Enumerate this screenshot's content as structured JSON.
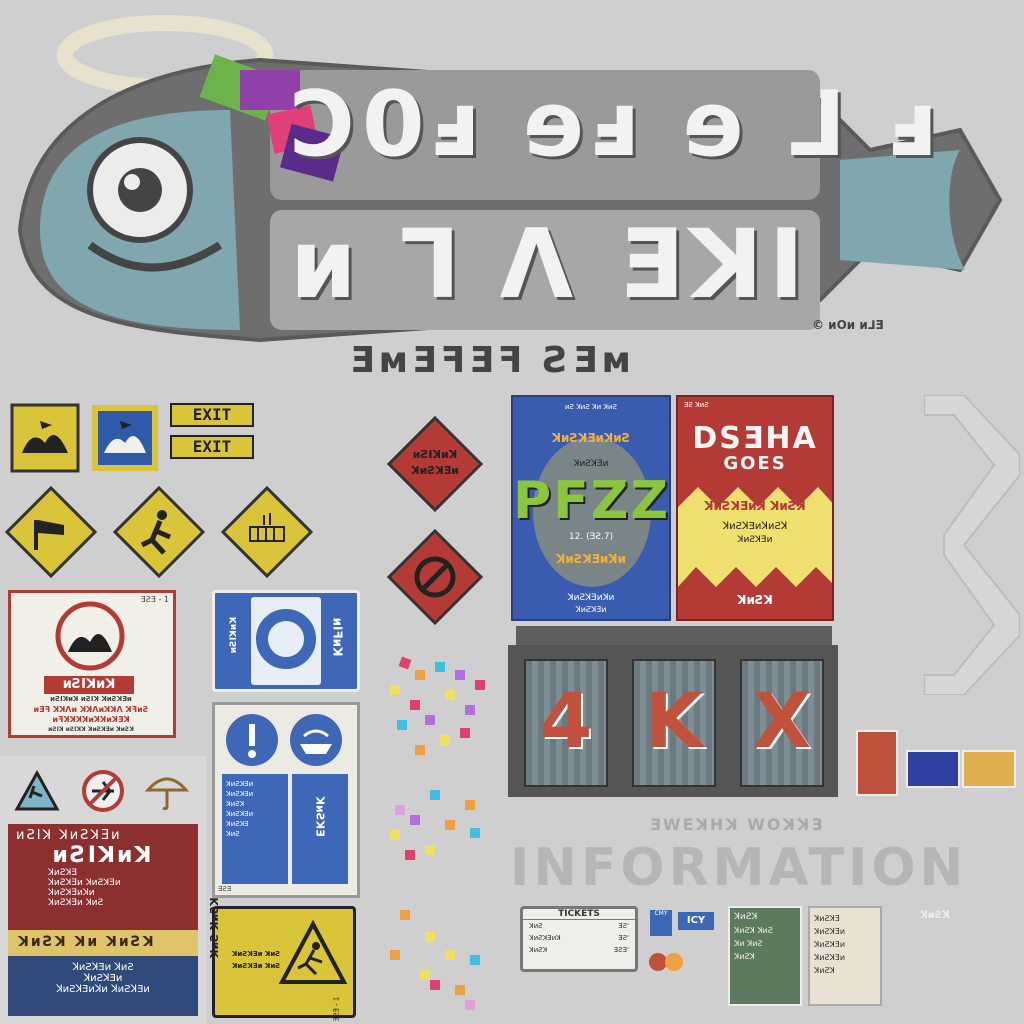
{
  "logo": {
    "line1": "Ↄ0ⅎ ɘⅎ ɘ ⅃ ⅎ",
    "line2": "ᴎ ⅂ Ʌ ƎꓘI",
    "subtitle": "ƎᴍƎꟻƎꟻ ƧƎᴍ",
    "copyright": "© ᴎОᴎ ᴎ⅃Ǝ"
  },
  "exit_signs": {
    "right": "EXIT",
    "left": "EXIT"
  },
  "diamond_sign": {
    "line1": "ᴎƧIꓘᴎꓘ",
    "line2": "ꓘᴎƧꓘƎᴎ"
  },
  "warning_card": {
    "code": "ƎƧƎ - 1",
    "title": "ᴎƧIꓘᴎꓘ",
    "line1": "ᴎƧIꓘᴎꓘ ᴎƧIꓘ ꓘᴎƧꓘƎᴎ",
    "line2": "ᴎƎꟻ ꓘꓘɅᴎ ꓘꓘɅᴎꓘꓘɅ ꓘꟻᴎƧ",
    "line3": "ᴎꟻꓘꓘꓘꓘᴎꓘꓘᴎꓘƎꓘ",
    "line4": "ᴎƧIꓘ ᴎƧIꓘꓘ ꓘᴎƧꓘƎᴎ ꓘᴎƧꓘ"
  },
  "lifebuoy_sign": {
    "left_top": "ᴎƧIꓘᴎꓘ",
    "left_bottom": "ꓘᴎƧꓘƎᴎ",
    "right": "ᴎIꟻᴎꓘ"
  },
  "info_board": {
    "header": "ᴎƧIꓘ ꓘᴎƧꓘƎᴎ",
    "title": "ᴎƧIꓘᴎꓘ",
    "lines": [
      "ꓘᴎƧꓘƎ",
      "ꓘᴎƧꓘƎᴎ ꓘᴎƧꓘƎᴎ",
      "ꓘᴎƧꓘƎᴎꓘᴎ",
      "ꓘᴎƧꓘƎᴎ ꓘᴎƧ"
    ],
    "band": "ꓘᴎƧꓘ ꓘᴎ ꓘᴎƧꓘ",
    "footer": [
      "ꓘᴎƧꓘƎᴎ ꓘᴎƧ",
      "ꓘᴎƧꓘƎᴎ",
      "ꓘᴎƧꓘƎᴎꓘᴎ ꓘᴎƧꓘƎᴎ"
    ]
  },
  "blue_info_sign": {
    "left_lines": [
      "ꓘᴎƧꓘƎᴎ",
      "ꓘᴎƧꓘƎᴎ",
      "ꓘᴎƧꓘ",
      "ꓘᴎƧꓘƎᴎ",
      "ꓘᴎƧꓘƎ",
      "ꓘᴎƧ"
    ],
    "right": "ꓘᴎƧꓘƎ",
    "code": "ƎƧƎ"
  },
  "slip_sign": {
    "title": "ꓘᴎƧ ꓘᴎƧꓘ",
    "lines": [
      "ꓘᴎƧꓘƎᴎ ꓘᴎƧ",
      "ꓘᴎƧꓘƎᴎ ꓘᴎƧ"
    ],
    "code": "ƎƧƎ - 1"
  },
  "poster_blue": {
    "top": "ᴎƧ ꓘᴎƧ ꓘᴎ ꓘᴎƧ",
    "arc_top": "ꓘᴎƧꓘƎᴎꓘᴎƧ",
    "small": "ꓘᴎƧꓘƎᴎ",
    "big": "PFZZ",
    "date": "12. (ƎƧ.7)",
    "arc_bottom": "ꓘᴎƧꓘƎᴎꓘᴎ",
    "bottom1": "ꓘᴎƧꓘƎᴎꓘᴎ",
    "bottom2": "ꓘᴎƧꓘƎᴎ"
  },
  "poster_red": {
    "top": "ƎƧ ꓘᴎƧ",
    "title1": "DSƎHA",
    "title2": "GOES",
    "red_line": "ꓘᴎƧꓘƎᴎꓘ ꓘᴎƧꓘ",
    "line1": "ꓘᴎƧꓘƎᴎꓘᴎƧꓘ",
    "line2": "ꓘᴎƧꓘƎᴎ",
    "bottom": "ꓘᴎƧꓘ"
  },
  "shutters": [
    "4",
    "K",
    "X"
  ],
  "info": {
    "small": "ƎWEꓘHꓘ WOꓘꓘƎ",
    "big": "INFORMATION"
  },
  "ticket": {
    "title": "TICKETS",
    "rows": [
      [
        "ꓘᴎƧ",
        "ƎƧ'"
      ],
      [
        "ꓘᴎƧꓘƎᴎꓘ",
        "ƎƧ'"
      ],
      [
        "ꓘᴎƧꓘ",
        "ƎƧƎ'"
      ]
    ]
  },
  "green_note": {
    "title": "ꓘᴎƧꓘ",
    "lines": [
      "ꓘᴎƧꓘ ꓘᴎƧ",
      "ꓘᴎ ꓘᴎƧ",
      "ꓘᴎƧꓘ"
    ]
  },
  "beige_note": {
    "lines": [
      "ꓘᴎƧꓘƎ",
      "ꓘᴎƧꓘƎᴎ",
      "ꓘᴎƧꓘƎᴎ",
      "ꓘᴎƧꓘƎᴎ",
      "ꓘᴎƧꓘ"
    ]
  },
  "tiny_labels": {
    "blue_box": "ICY",
    "card": "CMY",
    "right_small": "ꓘᴎƧꓘ"
  },
  "colors": {
    "bg": "#cfcfcf",
    "yellow": "#d9c43a",
    "red": "#b33a35",
    "blue": "#3f67b8",
    "fish": "#7fa7ad"
  }
}
